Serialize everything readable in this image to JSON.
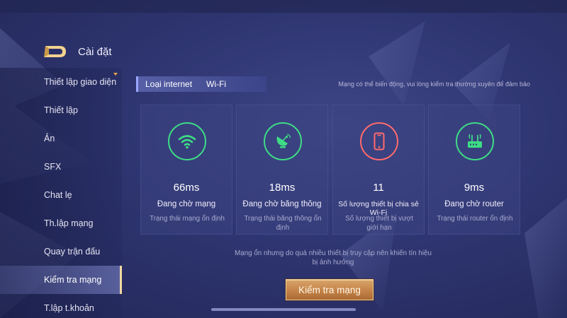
{
  "header": {
    "title": "Cài đặt",
    "back_icon": "back-arrow-icon"
  },
  "sidebar": {
    "items": [
      {
        "label": "Thiết lập giao diện",
        "active": false
      },
      {
        "label": "Thiết lập",
        "active": false
      },
      {
        "label": "Ản",
        "active": false
      },
      {
        "label": "SFX",
        "active": false
      },
      {
        "label": "Chat lẹ",
        "active": false
      },
      {
        "label": "Th.lập mạng",
        "active": false
      },
      {
        "label": "Quay trận đấu",
        "active": false
      },
      {
        "label": "Kiểm tra mạng",
        "active": true
      },
      {
        "label": "T.lập t.khoản",
        "active": false
      }
    ]
  },
  "main": {
    "internet_type_label": "Loại internet",
    "internet_type_value": "Wi-Fi",
    "notice": "Mạng có thể biến động, vui lòng kiểm tra thường xuyên để đảm bảo",
    "cards": [
      {
        "icon": "wifi-icon",
        "color": "#3ddc84",
        "value": "66ms",
        "status": "Đang chờ mạng",
        "desc": "Trạng thái mạng ổn định"
      },
      {
        "icon": "satellite-dish-icon",
        "color": "#3ddc84",
        "value": "18ms",
        "status": "Đang chờ băng thông",
        "desc": "Trạng thái băng thông ổn định"
      },
      {
        "icon": "phone-icon",
        "color": "#ff6b6b",
        "value": "11",
        "status": "Số lượng thiết bị chia sẻ Wi-Fi",
        "desc": "Số lượng thiết bị vượt giới hạn"
      },
      {
        "icon": "router-icon",
        "color": "#3ddc84",
        "value": "9ms",
        "status": "Đang chờ router",
        "desc": "Trạng thái router ổn định"
      }
    ],
    "footer_note": "Mạng ổn nhưng do quá nhiều thiết bị truy cập nên khiến tín hiệu bị ảnh hưởng",
    "check_button": "Kiểm tra mạng"
  },
  "colors": {
    "good": "#3ddc84",
    "bad": "#ff6b6b",
    "button": "#c48348",
    "background": "#2e3570"
  }
}
